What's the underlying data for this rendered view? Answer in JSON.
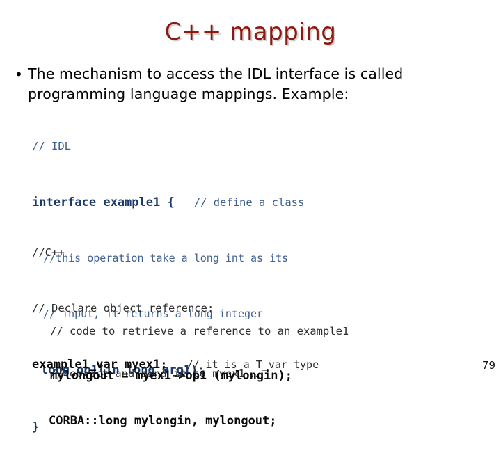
{
  "slide": {
    "title": "C++ mapping",
    "title_color": "#8C1A11",
    "background_color": "#ffffff",
    "page_number": "79"
  },
  "bullet": {
    "marker": "•",
    "text": "The mechanism to access the IDL interface is called programming language mappings. Example:"
  },
  "idl_block": {
    "color": "#1B3A6B",
    "lines": {
      "comment_idl": "// IDL",
      "interface_decl": "interface example1 {",
      "interface_trailing_comment": "// define a class",
      "note_1": "//this operation take a long int as its",
      "note_2": "// input, it returns a long integer",
      "operation": "long op1(in long arg1);",
      "close_brace": "}"
    }
  },
  "cpp_block": {
    "color": "#0A0A0A",
    "lines": {
      "comment_cpp": "//C++",
      "comment_declare": "// Declare object reference:",
      "declaration": "example1_var myex1;",
      "declaration_trailing_comment": "// it is a T_var type",
      "corba_decl": "CORBA::long mylongin, mylongout;"
    }
  },
  "note_block": {
    "lines": {
      "note_1": "// code to retrieve a reference to an example1",
      "note_2": "// object and bind it to myex1 …"
    }
  },
  "final_block": {
    "statement": "mylongout = myex1->op1 (mylongin);"
  }
}
